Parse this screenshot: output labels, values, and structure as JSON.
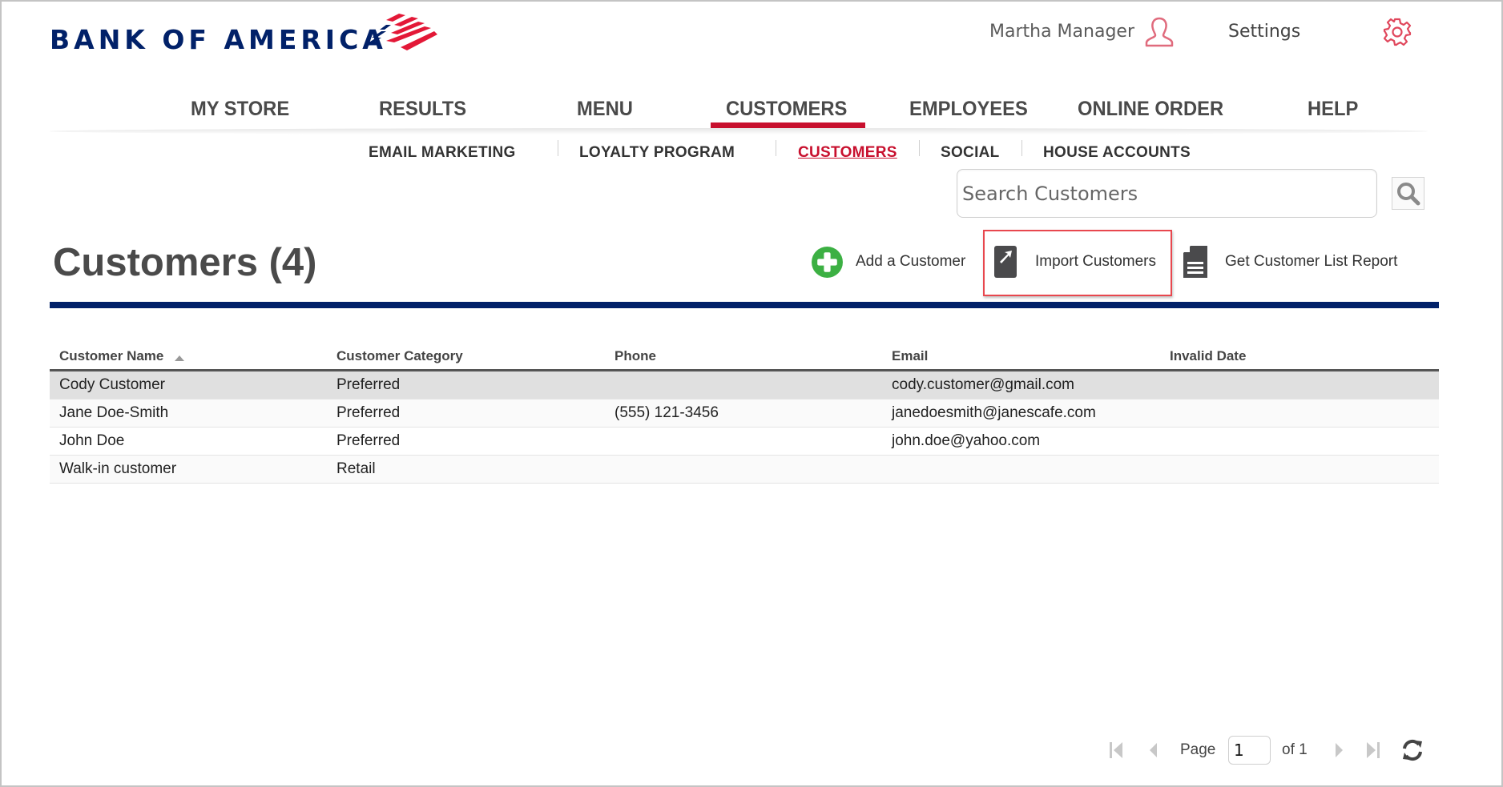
{
  "brand": {
    "name": "BANK OF AMERICA",
    "colors": {
      "navy": "#012169",
      "red": "#c8102e"
    }
  },
  "header": {
    "user_name": "Martha Manager",
    "user_icon": "person-icon",
    "settings_label": "Settings",
    "settings_icon": "gear-icon"
  },
  "main_nav": {
    "items": [
      {
        "label": "MY STORE",
        "active": false
      },
      {
        "label": "RESULTS",
        "active": false
      },
      {
        "label": "MENU",
        "active": false
      },
      {
        "label": "CUSTOMERS",
        "active": true
      },
      {
        "label": "EMPLOYEES",
        "active": false
      },
      {
        "label": "ONLINE ORDER",
        "active": false
      },
      {
        "label": "HELP",
        "active": false
      }
    ]
  },
  "sub_nav": {
    "items": [
      {
        "label": "EMAIL MARKETING",
        "active": false
      },
      {
        "label": "LOYALTY PROGRAM",
        "active": false
      },
      {
        "label": "CUSTOMERS",
        "active": true
      },
      {
        "label": "SOCIAL",
        "active": false
      },
      {
        "label": "HOUSE ACCOUNTS",
        "active": false
      }
    ]
  },
  "search": {
    "placeholder": "Search Customers",
    "value": "",
    "button_icon": "magnifier-icon"
  },
  "page": {
    "title": "Customers (4)",
    "actions": [
      {
        "label": "Add a Customer",
        "icon": "plus-circle-icon"
      },
      {
        "label": "Import Customers",
        "icon": "import-icon",
        "highlighted": true
      },
      {
        "label": "Get Customer List Report",
        "icon": "document-icon"
      }
    ]
  },
  "table": {
    "columns": [
      "Customer Name",
      "Customer Category",
      "Phone",
      "Email",
      "Invalid Date"
    ],
    "sort": {
      "column": "Customer Name",
      "direction": "ascending"
    },
    "rows": [
      {
        "name": "Cody Customer",
        "category": "Preferred",
        "phone": "",
        "email": "cody.customer@gmail.com",
        "invalid_date": "",
        "selected": true
      },
      {
        "name": "Jane Doe-Smith",
        "category": "Preferred",
        "phone": "(555) 121-3456",
        "email": "janedoesmith@janescafe.com",
        "invalid_date": ""
      },
      {
        "name": "John Doe",
        "category": "Preferred",
        "phone": "",
        "email": "john.doe@yahoo.com",
        "invalid_date": ""
      },
      {
        "name": "Walk-in customer",
        "category": "Retail",
        "phone": "",
        "email": "",
        "invalid_date": ""
      }
    ]
  },
  "pager": {
    "page_label": "Page",
    "current_page": "1",
    "of_label": "of 1",
    "total_pages": 1
  }
}
